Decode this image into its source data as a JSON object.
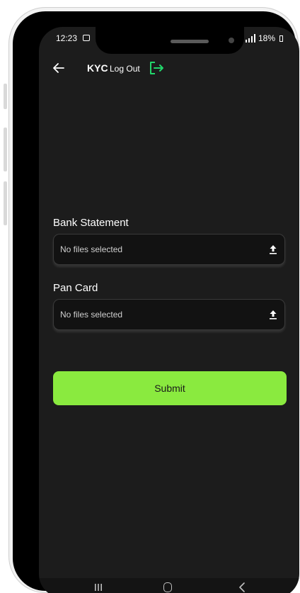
{
  "status_bar": {
    "time": "12:23",
    "battery": "18%"
  },
  "app_bar": {
    "title": "KYC",
    "logout_label": "Log Out"
  },
  "form": {
    "fields": [
      {
        "label": "Bank Statement",
        "value": "No files selected"
      },
      {
        "label": "Pan Card",
        "value": "No files selected"
      }
    ],
    "submit_label": "Submit"
  },
  "colors": {
    "accent": "#8aea3f",
    "logout_icon": "#22d66b",
    "screen_bg": "#1c1c1c"
  },
  "icons": {
    "back": "arrow-left-icon",
    "logout": "logout-icon",
    "upload": "upload-icon",
    "nav_recent": "recent-apps-icon",
    "nav_home": "home-icon",
    "nav_back": "chevron-left-icon"
  }
}
